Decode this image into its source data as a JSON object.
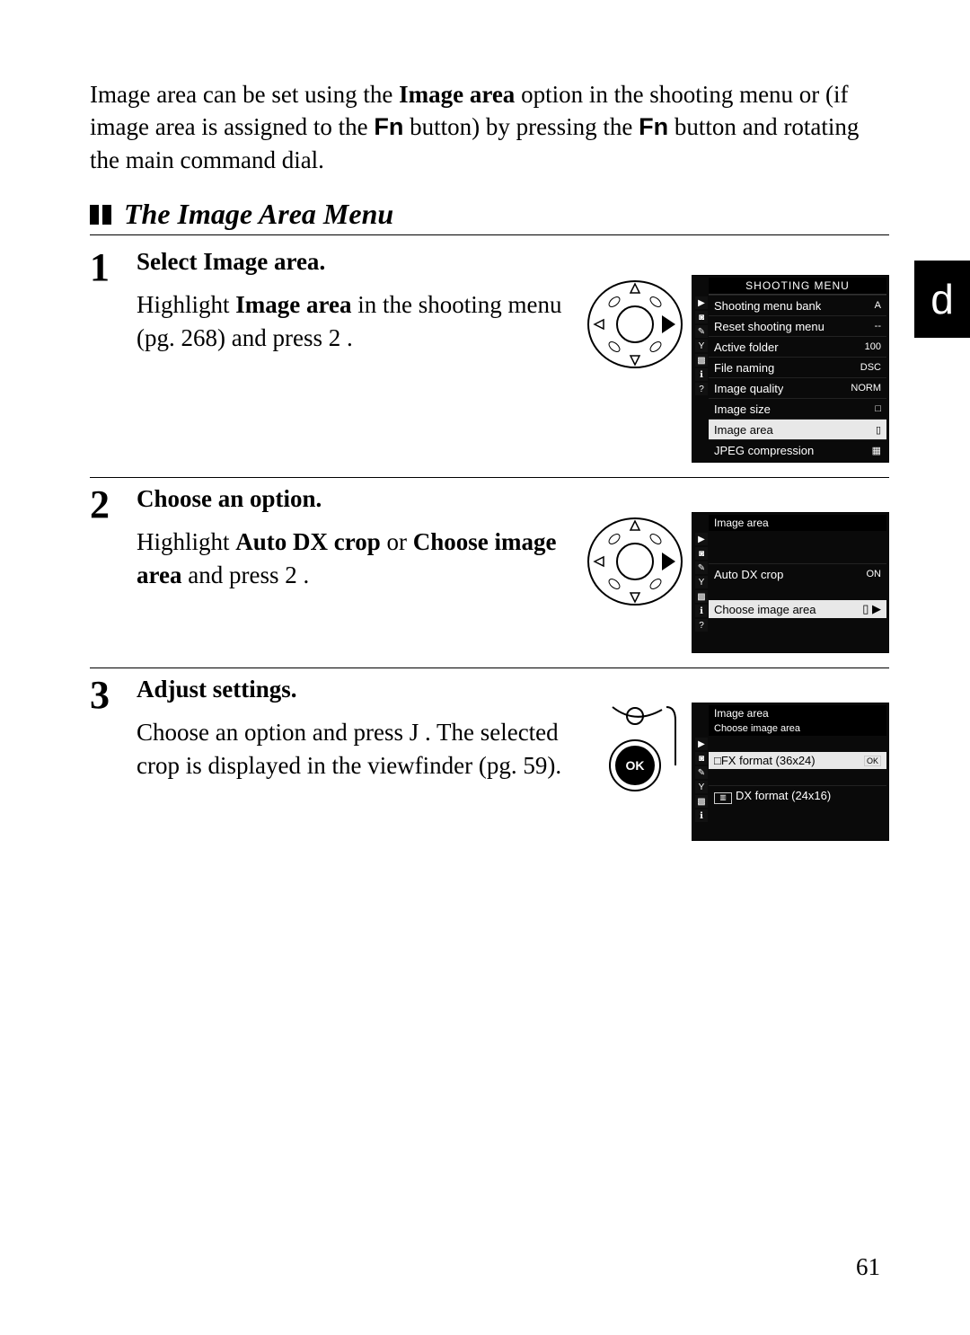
{
  "intro": {
    "t1": "Image area can be set using the ",
    "b1": "Image area",
    "t2": " option in the shooting menu or (if image area is assigned to the ",
    "fn": "Fn",
    "t3": " button) by pressing the ",
    "fn2": "Fn",
    "t4": " button and rotating the main command dial."
  },
  "section_title": "The Image Area Menu",
  "side_tab": "d",
  "page_number": "61",
  "steps": [
    {
      "num": "1",
      "heading_t1": "Select ",
      "heading_b1": "Image area",
      "heading_t2": ".",
      "desc_t1": "Highlight ",
      "desc_b1": "Image area",
      "desc_t2": " in the shooting menu (pg. 268) and press ",
      "desc_sym": "2",
      "desc_t3": " ."
    },
    {
      "num": "2",
      "heading_t1": "Choose an option.",
      "desc_t1": "Highlight ",
      "desc_b1": "Auto DX crop",
      "desc_t2": " or ",
      "desc_b2": "Choose image area",
      "desc_t3": " and press ",
      "desc_sym": "2",
      "desc_t4": " ."
    },
    {
      "num": "3",
      "heading_t1": "Adjust settings.",
      "desc_t1": "Choose an option and press ",
      "desc_sym": "J",
      "desc_t2": " . The selected crop is displayed in the viewfinder (pg. 59)."
    }
  ],
  "lcd1": {
    "title": "SHOOTING MENU",
    "rows": [
      {
        "label": "Shooting menu bank",
        "val": "A"
      },
      {
        "label": "Reset shooting menu",
        "val": "--"
      },
      {
        "label": "Active folder",
        "val": "100"
      },
      {
        "label": "File naming",
        "val": "DSC"
      },
      {
        "label": "Image quality",
        "val": "NORM"
      },
      {
        "label": "Image size",
        "val": "□"
      },
      {
        "label": "Image area",
        "val": "▯",
        "sel": true
      },
      {
        "label": "JPEG compression",
        "val": "▦"
      }
    ],
    "sideicons": [
      "▶",
      "◙",
      "✎",
      "Y",
      "▩",
      "ℹ",
      "?"
    ]
  },
  "lcd2": {
    "title": "Image area",
    "rows": [
      {
        "label": "Auto DX crop",
        "val": "ON"
      },
      {
        "label": "Choose image area",
        "val": "▯ ▶",
        "sel": true
      }
    ],
    "sideicons": [
      "▶",
      "◙",
      "✎",
      "Y",
      "▩",
      "ℹ",
      "?"
    ]
  },
  "lcd3": {
    "title": "Image area",
    "subtitle": "Choose image area",
    "rows": [
      {
        "label": "FX format (36x24)",
        "val": "OK",
        "sel": true,
        "pre": "□"
      },
      {
        "label": "DX format (24x16)",
        "val": "",
        "pre": "▥"
      }
    ],
    "sideicons": [
      "▶",
      "◙",
      "✎",
      "Y",
      "▩",
      "ℹ"
    ]
  },
  "ok_label": "OK"
}
